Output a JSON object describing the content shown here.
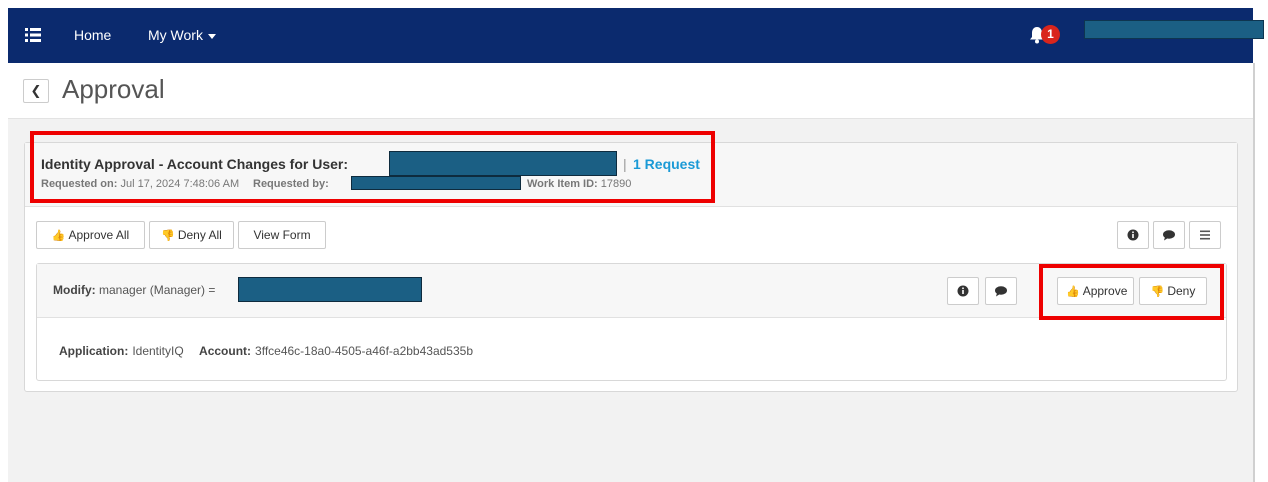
{
  "nav": {
    "menu_icon": "hamburger-list-icon",
    "home_label": "Home",
    "mywork_label": "My Work",
    "notifications_count": "1",
    "bell_icon": "bell-icon",
    "brand_color": "#0b2a6e"
  },
  "page": {
    "back_icon": "chevron-left-icon",
    "title": "Approval"
  },
  "request": {
    "title": "Identity Approval - Account Changes for User:",
    "count_label": "1 Request",
    "requested_on_label": "Requested on:",
    "requested_on_value": "Jul 17, 2024 7:48:06 AM",
    "requested_by_label": "Requested by:",
    "work_item_label": "Work Item ID:",
    "work_item_value": "17890"
  },
  "toolbar": {
    "approve_all_label": "Approve All",
    "deny_all_label": "Deny All",
    "view_form_label": "View Form",
    "icons": [
      "info-icon",
      "comment-icon",
      "menu-lines-icon"
    ]
  },
  "item": {
    "modify_label": "Modify:",
    "modify_text": "manager (Manager) =",
    "approve_label": "Approve",
    "deny_label": "Deny",
    "application_label": "Application:",
    "application_value": "IdentityIQ",
    "account_label": "Account:",
    "account_value": "3ffce46c-18a0-4505-a46f-a2bb43ad535b"
  },
  "colors": {
    "highlight": "#ee0000",
    "approve_icon": "#2e7d1a",
    "deny_icon": "#d9251c",
    "link": "#1b9ad6",
    "redaction": "#1b5f84"
  }
}
